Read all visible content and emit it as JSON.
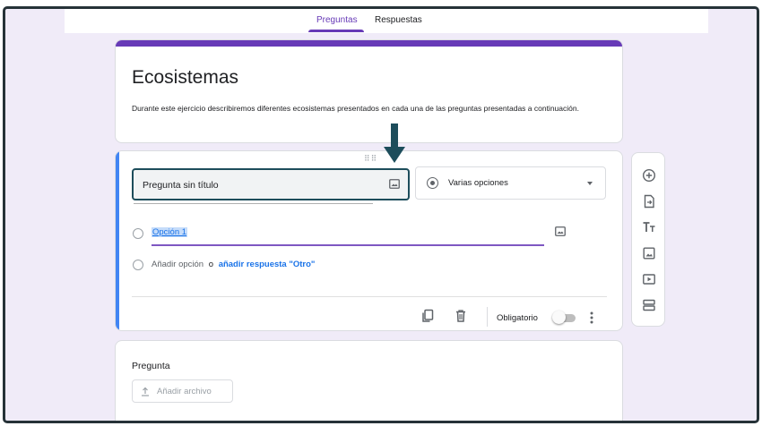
{
  "tabs": [
    {
      "label": "Preguntas",
      "active": true
    },
    {
      "label": "Respuestas",
      "active": false
    }
  ],
  "form": {
    "title": "Ecosistemas",
    "description": "Durante este ejercicio describiremos diferentes ecosistemas presentados en cada una de las preguntas presentadas a continuación."
  },
  "question": {
    "title": "Pregunta sin título",
    "type": "Varias opciones",
    "options": [
      "Opción 1"
    ],
    "add_option": "Añadir opción",
    "or": "o",
    "add_other": "añadir respuesta \"Otro\"",
    "required_label": "Obligatorio",
    "required": false
  },
  "question2": {
    "label": "Pregunta",
    "upload_label": "Añadir archivo"
  },
  "side_toolbar": [
    "add-question-icon",
    "import-questions-icon",
    "add-title-icon",
    "add-image-icon",
    "add-video-icon",
    "add-section-icon"
  ],
  "colors": {
    "accent": "#673ab7",
    "active_question": "#4285f4",
    "link": "#1a73e8",
    "highlight_box": "#1d4d5b",
    "background": "#f0ebf8"
  }
}
